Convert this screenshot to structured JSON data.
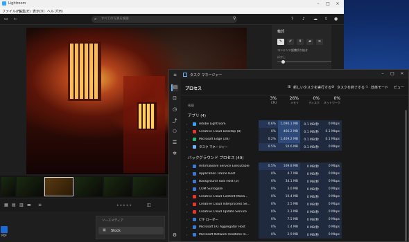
{
  "colors": {
    "cell_low": "#1f2a3e",
    "cell_mid": "#253656",
    "cell_high": "#2d4a7a",
    "accent": "#6fb3ff",
    "lightroom_blue": "#31a8ff"
  },
  "lightroom": {
    "title": "Lightroom",
    "menu": [
      "ファイル(F)",
      "編集(E)",
      "表示(V)",
      "ヘルプ(H)"
    ],
    "search_placeholder": "すべての写真を検索",
    "panel": {
      "title": "輪郭",
      "slider_label": "コンテンツ認識切り抜き",
      "slider_sub": "ぼかし"
    },
    "popup": {
      "header": "ソースメディア",
      "item": "Stock"
    }
  },
  "taskmanager": {
    "title": "タスク マネージャー",
    "heading": "プロセス",
    "actions": {
      "new_task": "新しいタスクを実行する",
      "end_task": "タスクを終了する",
      "efficiency": "効率モード",
      "view": "ビュー"
    },
    "columns": {
      "name": "名前",
      "cpu_pct": "3%",
      "cpu": "CPU",
      "mem_pct": "26%",
      "mem": "メモリ",
      "disk_pct": "0%",
      "disk": "ディスク",
      "net_pct": "0%",
      "net": "ネットワーク"
    },
    "apps_section": "アプリ (4)",
    "bg_section": "バックグラウンド プロセス (49)",
    "apps": [
      {
        "name": "Adobe Lightroom",
        "cpu": "0.6%",
        "mem": "1,096.1 MB",
        "disk": "0.1 MB/秒",
        "net": "0 Mbps",
        "icon_color": "#31a8ff"
      },
      {
        "name": "Creative Cloud Desktop (8)",
        "cpu": "0%",
        "mem": "466.2 MB",
        "disk": "0.1 MB/秒",
        "net": "0.1 Mbps",
        "icon_color": "#e8362d"
      },
      {
        "name": "Microsoft Edge (28)",
        "cpu": "0.2%",
        "mem": "1,469.2 MB",
        "disk": "0.1 MB/秒",
        "net": "0.1 Mbps",
        "icon_color": "#2fb27a"
      },
      {
        "name": "タスク マネージャー",
        "cpu": "0.5%",
        "mem": "50.6 MB",
        "disk": "0.1 MB/秒",
        "net": "0 Mbps",
        "icon_color": "#6fb3ff"
      }
    ],
    "background": [
      {
        "name": "Antimalware Service Executable",
        "cpu": "0.5%",
        "mem": "169.8 MB",
        "disk": "0 MB/秒",
        "net": "0 Mbps",
        "icon_color": "#3a7bd5"
      },
      {
        "name": "Application Frame Host",
        "cpu": "0%",
        "mem": "4.7 MB",
        "disk": "0 MB/秒",
        "net": "0 Mbps",
        "icon_color": "#3a7bd5"
      },
      {
        "name": "Background Task Host (3)",
        "cpu": "0%",
        "mem": "34.1 MB",
        "disk": "0 MB/秒",
        "net": "0 Mbps",
        "icon_color": "#3a7bd5"
      },
      {
        "name": "COM Surrogate",
        "cpu": "0%",
        "mem": "3.0 MB",
        "disk": "0 MB/秒",
        "net": "0 Mbps",
        "icon_color": "#3a7bd5"
      },
      {
        "name": "Creative Cloud Content Mana...",
        "cpu": "0%",
        "mem": "10.4 MB",
        "disk": "0 MB/秒",
        "net": "0 Mbps",
        "icon_color": "#e8362d"
      },
      {
        "name": "Creative Cloud Interprocess Se...",
        "cpu": "0%",
        "mem": "2.5 MB",
        "disk": "0 MB/秒",
        "net": "0 Mbps",
        "icon_color": "#e8362d"
      },
      {
        "name": "Creative Cloud Update Service",
        "cpu": "0%",
        "mem": "2.3 MB",
        "disk": "0 MB/秒",
        "net": "0 Mbps",
        "icon_color": "#e8362d"
      },
      {
        "name": "CTF ローダー",
        "cpu": "0%",
        "mem": "7.5 MB",
        "disk": "0 MB/秒",
        "net": "0 Mbps",
        "icon_color": "#3a7bd5"
      },
      {
        "name": "Microsoft (R) Aggregator Host",
        "cpu": "0%",
        "mem": "1.4 MB",
        "disk": "0 MB/秒",
        "net": "0 Mbps",
        "icon_color": "#3a7bd5"
      },
      {
        "name": "Microsoft Network Realtime In...",
        "cpu": "0%",
        "mem": "2.9 MB",
        "disk": "0 MB/秒",
        "net": "0 Mbps",
        "icon_color": "#3a7bd5"
      }
    ]
  }
}
